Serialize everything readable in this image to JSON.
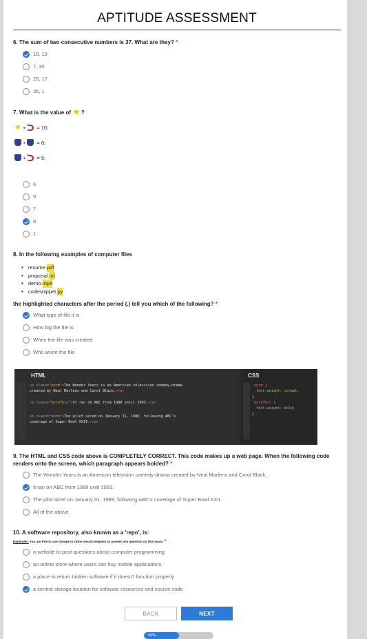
{
  "title": "APTITUDE ASSESSMENT",
  "q6": {
    "text": "6. The sum of two consecutive numbers is 37.  What are they?",
    "required": "*",
    "options": [
      "18, 19",
      "7, 30",
      "20, 17",
      "36, 1"
    ],
    "selected": 0
  },
  "q7": {
    "text": "7. What is the value of",
    "suffix": "?",
    "equations": [
      {
        "left": "star-icon",
        "right": "magnet-icon",
        "result": "= 10;"
      },
      {
        "left": "cup-icon",
        "right": "cup-icon",
        "result": "= 6;"
      },
      {
        "left": "cup-icon",
        "right": "magnet-icon",
        "result": "= 5;"
      }
    ],
    "options": [
      "6",
      "9",
      "7",
      "8",
      "1"
    ],
    "selected": 3
  },
  "q8": {
    "text": "8. In the following examples of computer files",
    "files": [
      {
        "base": "resume.",
        "ext": "pdf"
      },
      {
        "base": "proposal.",
        "ext": "txt"
      },
      {
        "base": "demo.",
        "ext": "mp4"
      },
      {
        "base": "codesnippet.",
        "ext": "py"
      }
    ],
    "question": "the highlighted characters after the period (.) tell you which of the following?",
    "required": "*",
    "options": [
      "What type of file it is",
      "How big the file is",
      "When the file was created",
      "Who wrote the file"
    ],
    "selected": 0
  },
  "code": {
    "html_header": "HTML",
    "css_header": "CSS",
    "html_lines": [
      {
        "cls": "norm",
        "text": "The Wonder Years is an American television comedy-drama",
        "cont": "created by Neal Marlens and Carol Black."
      },
      {
        "cls": "boldThis",
        "text": "It ran on ABC from 1988 until 1993.",
        "cont": ""
      },
      {
        "cls": "norm",
        "text": "The pilot aired on January 31, 1988, following ABC's",
        "cont": "coverage of Super Bowl XXII."
      }
    ],
    "css_lines": [
      ".norm {",
      "font-weight: normal;",
      "}",
      ".boldThis {",
      "font-weight: bold;",
      "}"
    ]
  },
  "q9": {
    "text": "9. The HTML and CSS code above is COMPLETELY CORRECT. This code makes up a web page. When the following code renders onto the screen, which paragraph appears bolded?",
    "required": "*",
    "options": [
      "The Wonder Years is an American television comedy-drama created by Neal Marlens and Carol Black.",
      "It ran on ABC from 1988 until 1993.",
      "The pilot aired on January 31, 1988, following ABC's coverage of Super Bowl XXII.",
      "All of the above"
    ],
    "selected": 1
  },
  "q10": {
    "text": "10. A software repository, also known as a 'repo', is:",
    "reminder_label": "Reminder:",
    "reminder_text": " You are free to use Google or other search engines to answer any question on this exam.",
    "required": "*",
    "options": [
      "a website to post questions about computer programming",
      "an online store where users can buy mobile applications",
      "a place to return broken software if it doesn't function properly",
      "a central storage location for software resources and source code"
    ],
    "selected": 3
  },
  "nav": {
    "back": "BACK",
    "next": "NEXT"
  },
  "progress": {
    "label": "50%",
    "value": 0.5
  }
}
